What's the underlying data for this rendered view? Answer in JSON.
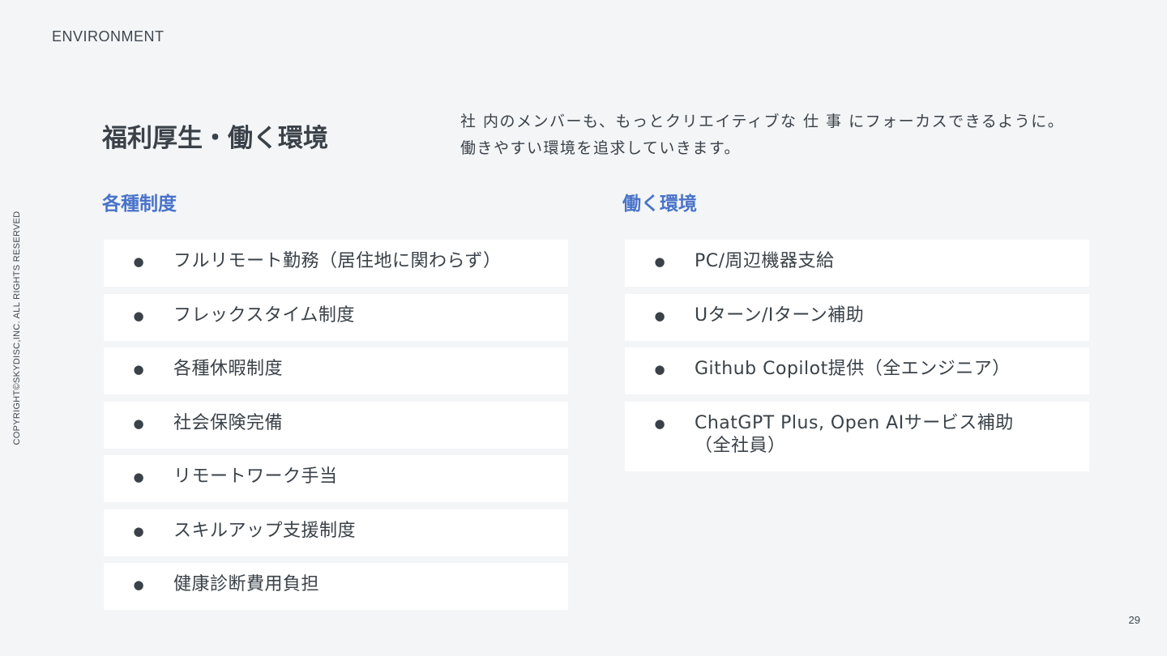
{
  "header": {
    "section_label": "ENVIRONMENT"
  },
  "sidebar": {
    "copyright": "COPYRIGHT©SKYDISC,INC. ALL RIGHTS RESERVED"
  },
  "main": {
    "title": "福利厚生・働く環境",
    "lead_line1": "社 内のメンバーも、もっとクリエイティブな 仕 事 にフォーカスできるように。",
    "lead_line2": "働きやすい環境を追求していきます。",
    "left_column": {
      "heading": "各種制度",
      "items": [
        {
          "bullet": "●",
          "text": "フルリモート勤務（居住地に関わらず）"
        },
        {
          "bullet": "●",
          "text": "フレックスタイム制度"
        },
        {
          "bullet": "●",
          "text": "各種休暇制度"
        },
        {
          "bullet": "●",
          "text": "社会保険完備"
        },
        {
          "bullet": "●",
          "text": "リモートワーク手当"
        },
        {
          "bullet": "●",
          "text": "スキルアップ支援制度"
        },
        {
          "bullet": "●",
          "text": "健康診断費用負担"
        }
      ]
    },
    "right_column": {
      "heading": "働く環境",
      "items": [
        {
          "bullet": "●",
          "text": "PC/周辺機器支給"
        },
        {
          "bullet": "●",
          "text": "Uターン/Iターン補助"
        },
        {
          "bullet": "●",
          "text": "Github Copilot提供（全エンジニア）"
        },
        {
          "bullet": "●",
          "text": "ChatGPT Plus, Open AIサービス補助",
          "text2": "（全社員）"
        }
      ]
    }
  },
  "footer": {
    "page_number": "29"
  },
  "colors": {
    "background": "#f3f5f7",
    "accent": "#4a73c9",
    "text": "#3a4148",
    "card": "#ffffff"
  }
}
